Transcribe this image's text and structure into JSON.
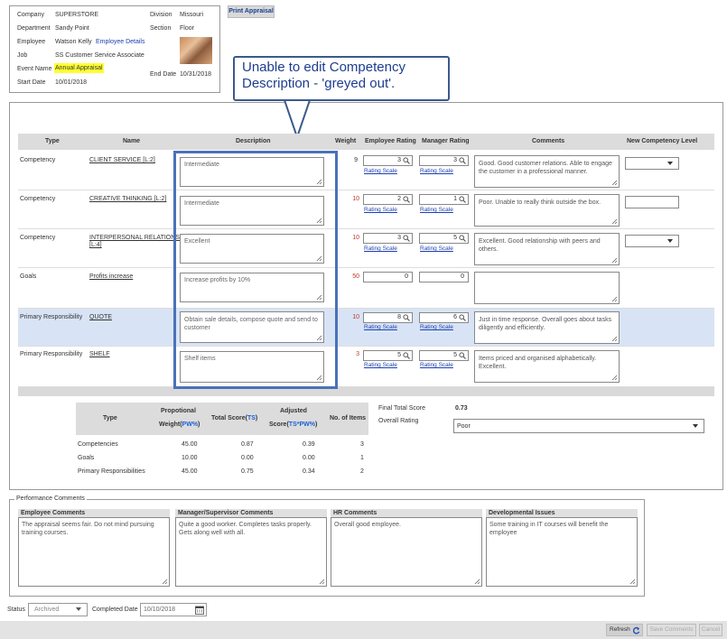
{
  "header": {
    "company_label": "Company",
    "company": "SUPERSTORE",
    "department_label": "Department",
    "department": "Sandy Point",
    "employee_label": "Employee",
    "employee": "Watson Kelly",
    "employee_details_link": "Employee Details",
    "job_label": "Job",
    "job": "SS Customer Service Associate",
    "event_label": "Event Name",
    "event": "Annual Appraisal",
    "start_label": "Start Date",
    "start": "10/01/2018",
    "division_label": "Division",
    "division": "Missouri",
    "section_label": "Section",
    "section": "Floor",
    "end_label": "End Date",
    "end": "10/31/2018"
  },
  "print_button": "Print Appraisal",
  "callout": {
    "line1": "Unable to edit Competency",
    "line2": "Description - 'greyed out'."
  },
  "table": {
    "headers": [
      "Type",
      "Name",
      "Description",
      "Weight",
      "Employee Rating",
      "Manager Rating",
      "Comments",
      "New Competency Level"
    ],
    "rating_scale": "Rating Scale",
    "rows": [
      {
        "type": "Competency",
        "name": "CLIENT SERVICE [L:2]",
        "name2": "",
        "desc": "Intermediate",
        "weight": "9",
        "emp": "3",
        "mgr": "3",
        "comment": "Good.  Good customer relations.  Able to engage the customer in a professional manner."
      },
      {
        "type": "Competency",
        "name": "CREATIVE THINKING [L:2]",
        "name2": "",
        "desc": "Intermediate",
        "weight": "10",
        "emp": "2",
        "mgr": "1",
        "comment": "Poor.  Unable to really think outside the box."
      },
      {
        "type": "Competency",
        "name": "INTERPERSONAL RELATIONS",
        "name2": "[L:4]",
        "desc": "Excellent",
        "weight": "10",
        "emp": "3",
        "mgr": "5",
        "comment": "Excellent.  Good relationship with peers and others."
      },
      {
        "type": "Goals",
        "name": "Profits increase",
        "name2": "",
        "desc": "Increase profits by 10%",
        "weight": "50",
        "emp": "0",
        "mgr": "0",
        "comment": ""
      },
      {
        "type": "Primary Responsibility",
        "name": "QUOTE",
        "name2": "",
        "desc": "Obtain sale details, compose quote and send to customer",
        "weight": "10",
        "emp": "8",
        "mgr": "6",
        "comment": "Just in time response.  Overall goes about tasks diligently and efficiently."
      },
      {
        "type": "Primary Responsibility",
        "name": "SHELF",
        "name2": "",
        "desc": "Shelf items",
        "weight": "3",
        "emp": "5",
        "mgr": "5",
        "comment": "Items priced and organised alphabetically.  Excellent."
      }
    ]
  },
  "summary": {
    "h_type": "Type",
    "h_prop1": "Propotional",
    "h_prop2": "Weight(",
    "h_pw": "PW%",
    "h_close": ")",
    "h_total": "Total Score(",
    "h_ts": "TS",
    "h_adj1": "Adjusted",
    "h_adj2": "Score(",
    "h_star": "*",
    "h_items": "No. of Items",
    "rows": [
      {
        "type": "Competencies",
        "weight": "45.00",
        "total": "0.87",
        "adjusted": "0.39",
        "items": "3"
      },
      {
        "type": "Goals",
        "weight": "10.00",
        "total": "0.00",
        "adjusted": "0.00",
        "items": "1"
      },
      {
        "type": "Primary Responsibilities",
        "weight": "45.00",
        "total": "0.75",
        "adjusted": "0.34",
        "items": "2"
      }
    ],
    "final_label": "Final Total Score",
    "final": "0.73",
    "overall_label": "Overall Rating",
    "overall": "Poor"
  },
  "performance": {
    "legend": "Performance Comments",
    "cols": [
      {
        "title": "Employee Comments",
        "text": "The appraisal seems fair.  Do not mind pursuing training courses."
      },
      {
        "title": "Manager/Supervisor Comments",
        "text": "Quite a good worker.  Completes tasks properly. Gets along well with all."
      },
      {
        "title": "HR Comments",
        "text": "Overall good employee."
      },
      {
        "title": "Developmental Issues",
        "text": "Some training in IT courses will benefit the employee"
      }
    ]
  },
  "status": {
    "label": "Status",
    "value": "Archived",
    "completed_label": "Completed Date",
    "completed": "10/10/2018"
  },
  "footer": {
    "refresh": "Refresh",
    "save": "Save Comments",
    "cancel": "Cancel"
  }
}
